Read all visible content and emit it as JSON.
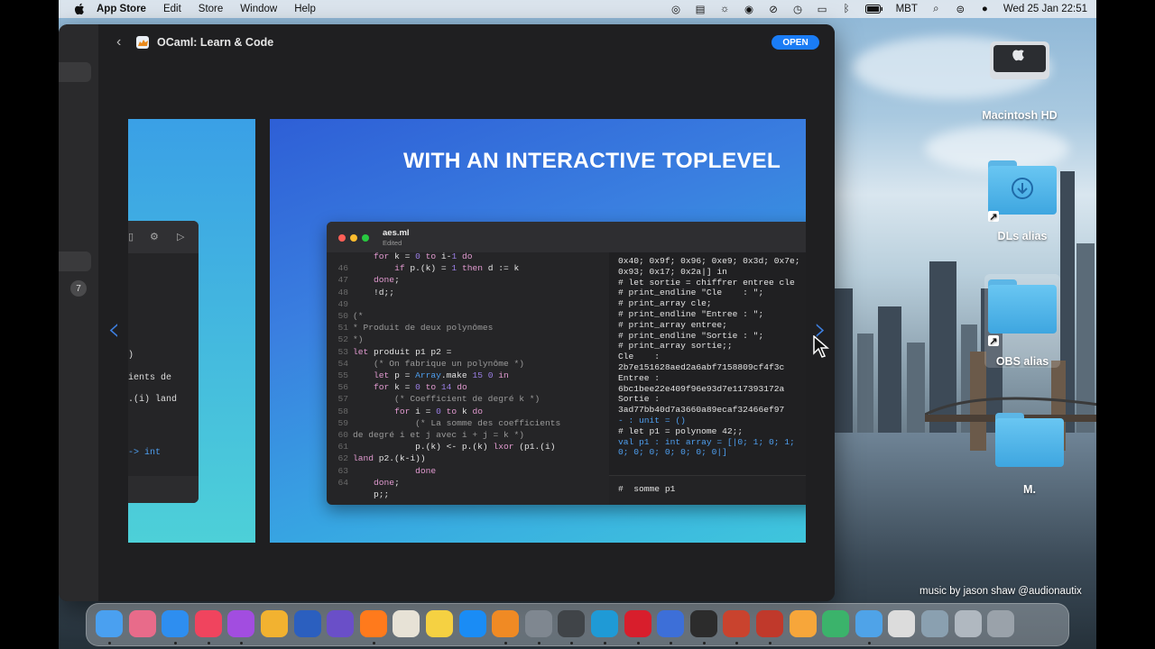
{
  "menubar": {
    "app_name": "App Store",
    "items": [
      "Edit",
      "Store",
      "Window",
      "Help"
    ],
    "input_source": "MBT",
    "datetime": "Wed 25 Jan  22:51"
  },
  "window": {
    "back_label": "‹",
    "app_title": "OCaml: Learn & Code",
    "open_label": "OPEN",
    "sidebar_badge": "7",
    "screenshot1": {
      "lines": [
        ")",
        "ients de",
        ".(i) land",
        "-> int"
      ]
    },
    "screenshot2": {
      "headline": "WITH AN INTERACTIVE TOPLEVEL",
      "file_name": "aes.ml",
      "file_status": "Edited",
      "editor_lines": [
        {
          "n": "",
          "t": "    for k = 0 to i-1 do"
        },
        {
          "n": "46",
          "t": "        if p.(k) = 1 then d := k"
        },
        {
          "n": "47",
          "t": "    done;"
        },
        {
          "n": "48",
          "t": "    !d;;"
        },
        {
          "n": "49",
          "t": ""
        },
        {
          "n": "50",
          "t": "(*"
        },
        {
          "n": "51",
          "t": "* Produit de deux polynômes"
        },
        {
          "n": "52",
          "t": "*)"
        },
        {
          "n": "53",
          "t": "let produit p1 p2 ="
        },
        {
          "n": "54",
          "t": "    (* On fabrique un polynôme *)"
        },
        {
          "n": "55",
          "t": "    let p = Array.make 15 0 in"
        },
        {
          "n": "56",
          "t": "    for k = 0 to 14 do"
        },
        {
          "n": "57",
          "t": "        (* Coefficient de degré k *)"
        },
        {
          "n": "58",
          "t": "        for i = 0 to k do"
        },
        {
          "n": "59",
          "t": "            (* La somme des coefficients"
        },
        {
          "n": "60",
          "t": "de degré i et j avec i + j = k *)"
        },
        {
          "n": "61",
          "t": "            p.(k) <- p.(k) lxor (p1.(i)"
        },
        {
          "n": "62",
          "t": "land p2.(k-i))"
        },
        {
          "n": "63",
          "t": "            done"
        },
        {
          "n": "64",
          "t": "    done;"
        },
        {
          "n": "",
          "t": "    p;;"
        }
      ],
      "toplevel_lines": [
        "0x40; 0x9f; 0x96; 0xe9; 0x3d; 0x7e;",
        "0x93; 0x17; 0x2a|] in",
        "# let sortie = chiffrer entree cle",
        "# print_endline \"Cle    : \";",
        "# print_array cle;",
        "# print_endline \"Entree : \";",
        "# print_array entree;",
        "# print_endline \"Sortie : \";",
        "# print_array sortie;;",
        "Cle    :",
        "2b7e151628aed2a6abf7158809cf4f3c",
        "Entree :",
        "6bc1bee22e409f96e93d7e117393172a",
        "Sortie :",
        "3ad77bb40d7a3660a89ecaf32466ef97",
        "- : unit = ()",
        "# let p1 = polynome 42;;",
        "val p1 : int array = [|0; 1; 0; 1;",
        "0; 0; 0; 0; 0; 0; 0|]"
      ],
      "prompt": "#  somme p1"
    }
  },
  "desktop": {
    "icons": [
      {
        "label": "Macintosh HD"
      },
      {
        "label": "DLs alias"
      },
      {
        "label": "OBS alias"
      },
      {
        "label": "M."
      }
    ]
  },
  "credit": "music by jason shaw @audionautix",
  "dock": {
    "apps": [
      "Finder",
      "Launchpad",
      "Safari",
      "Music",
      "Podcasts",
      "Photos",
      "Word",
      "Font Book",
      "Firefox",
      "TextEdit",
      "Notes",
      "App Store",
      "Books",
      "System Preferences",
      "OBS",
      "Edge",
      "Opera",
      "Screen",
      "Activity Monitor",
      "PowerPoint",
      "Photo Booth",
      "Notes2",
      "Copilot",
      "OCaml",
      "Music Folder",
      "Documents",
      "Downloads",
      "Trash"
    ]
  }
}
